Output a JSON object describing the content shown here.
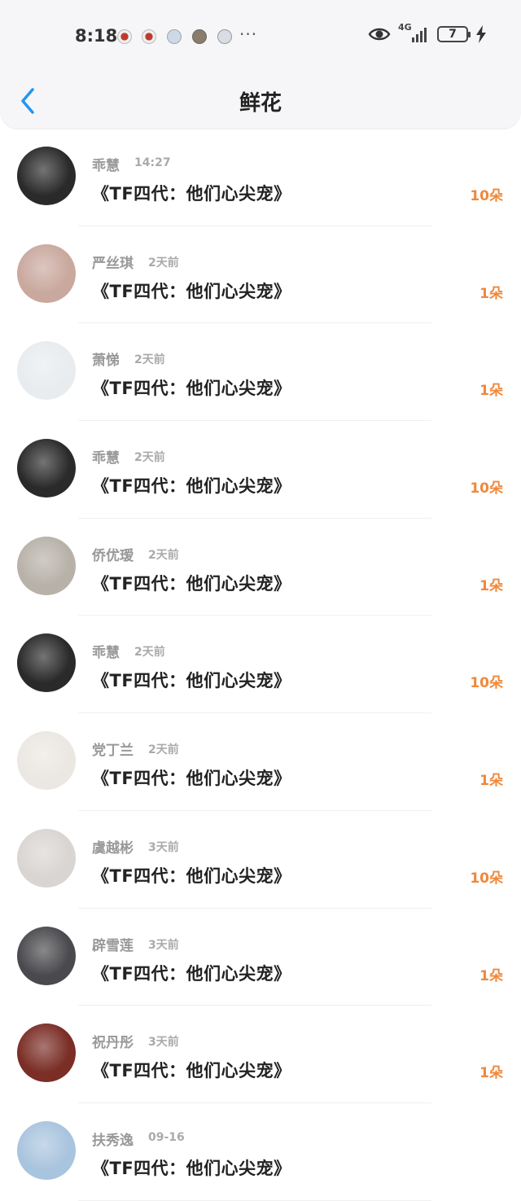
{
  "status_bar": {
    "time": "8:18",
    "more": "···",
    "network": "4G",
    "battery": "7"
  },
  "header": {
    "title": "鲜花"
  },
  "icons": {
    "back": "chevron-left-icon",
    "eye": "eye-icon",
    "signal": "signal-icon",
    "battery": "battery-icon",
    "charging": "charging-bolt-icon"
  },
  "colors": {
    "accent_back": "#2196f3",
    "count": "#f0883a"
  },
  "flowers": [
    {
      "name": "乖慧",
      "time": "14:27",
      "book": "《TF四代：他们心尖宠》",
      "count": "10朵",
      "avatar": "#2a2a2a"
    },
    {
      "name": "严丝琪",
      "time": "2天前",
      "book": "《TF四代：他们心尖宠》",
      "count": "1朵",
      "avatar": "#c9a89e"
    },
    {
      "name": "萧悌",
      "time": "2天前",
      "book": "《TF四代：他们心尖宠》",
      "count": "1朵",
      "avatar": "#e8ecee"
    },
    {
      "name": "乖慧",
      "time": "2天前",
      "book": "《TF四代：他们心尖宠》",
      "count": "10朵",
      "avatar": "#2a2a2a"
    },
    {
      "name": "侨优瑷",
      "time": "2天前",
      "book": "《TF四代：他们心尖宠》",
      "count": "1朵",
      "avatar": "#b7b1a8"
    },
    {
      "name": "乖慧",
      "time": "2天前",
      "book": "《TF四代：他们心尖宠》",
      "count": "10朵",
      "avatar": "#2a2a2a"
    },
    {
      "name": "党丁兰",
      "time": "2天前",
      "book": "《TF四代：他们心尖宠》",
      "count": "1朵",
      "avatar": "#ebe7e2"
    },
    {
      "name": "虞越彬",
      "time": "3天前",
      "book": "《TF四代：他们心尖宠》",
      "count": "10朵",
      "avatar": "#d9d5d2"
    },
    {
      "name": "辟雪莲",
      "time": "3天前",
      "book": "《TF四代：他们心尖宠》",
      "count": "1朵",
      "avatar": "#4a4a4e"
    },
    {
      "name": "祝丹彤",
      "time": "3天前",
      "book": "《TF四代：他们心尖宠》",
      "count": "1朵",
      "avatar": "#7a2e26"
    },
    {
      "name": "扶秀逸",
      "time": "09-16",
      "book": "《TF四代：他们心尖宠》",
      "count": "",
      "avatar": "#a9c4de"
    }
  ]
}
